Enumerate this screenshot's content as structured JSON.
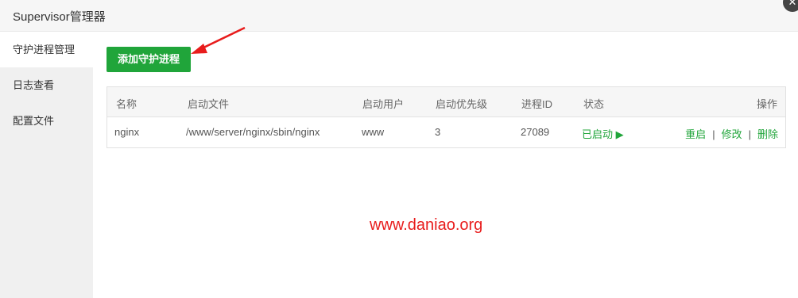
{
  "window": {
    "title": "Supervisor管理器",
    "close_symbol": "✕"
  },
  "sidebar": {
    "items": [
      {
        "label": "守护进程管理",
        "active": true
      },
      {
        "label": "日志查看",
        "active": false
      },
      {
        "label": "配置文件",
        "active": false
      }
    ]
  },
  "toolbar": {
    "add_label": "添加守护进程"
  },
  "table": {
    "headers": [
      "名称",
      "启动文件",
      "启动用户",
      "启动优先级",
      "进程ID",
      "状态",
      "操作"
    ],
    "rows": [
      {
        "name": "nginx",
        "file": "/www/server/nginx/sbin/nginx",
        "user": "www",
        "priority": "3",
        "pid": "27089",
        "status": "已启动 ▶",
        "actions": [
          "重启",
          "修改",
          "删除"
        ]
      }
    ]
  },
  "watermark": "www.daniao.org",
  "colors": {
    "accent": "#20a53a",
    "watermark": "#e81c1c",
    "arrow": "#e81c1c"
  }
}
